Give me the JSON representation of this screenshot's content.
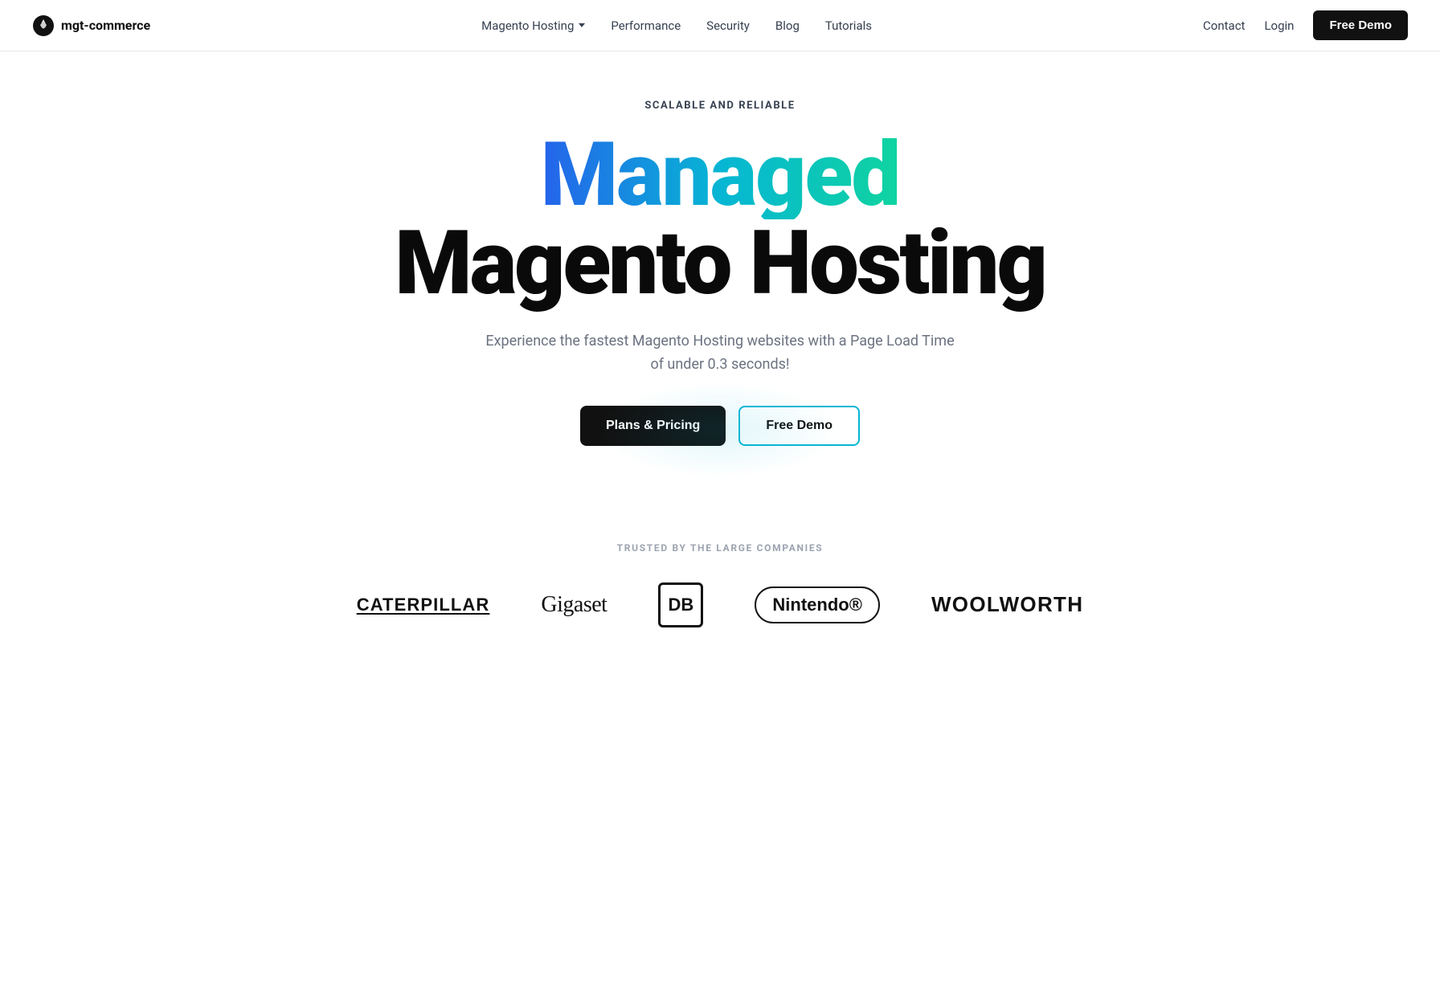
{
  "nav": {
    "logo_text": "mgt-commerce",
    "links": [
      {
        "label": "Magento Hosting",
        "has_dropdown": true
      },
      {
        "label": "Performance",
        "has_dropdown": false
      },
      {
        "label": "Security",
        "has_dropdown": false
      },
      {
        "label": "Blog",
        "has_dropdown": false
      },
      {
        "label": "Tutorials",
        "has_dropdown": false
      }
    ],
    "right": {
      "contact": "Contact",
      "login": "Login",
      "free_demo": "Free Demo"
    }
  },
  "hero": {
    "eyebrow": "SCALABLE AND RELIABLE",
    "heading_line1": "Managed",
    "heading_line2": "Magento Hosting",
    "subtext": "Experience the fastest Magento Hosting websites with a Page Load Time of under 0.3 seconds!",
    "cta_plans": "Plans & Pricing",
    "cta_demo": "Free Demo"
  },
  "trusted": {
    "eyebrow": "TRUSTED BY THE LARGE COMPANIES",
    "logos": [
      {
        "name": "CATERPILLAR"
      },
      {
        "name": "Gigaset"
      },
      {
        "name": "DB"
      },
      {
        "name": "Nintendo®"
      },
      {
        "name": "WOOLWORTH"
      }
    ]
  }
}
